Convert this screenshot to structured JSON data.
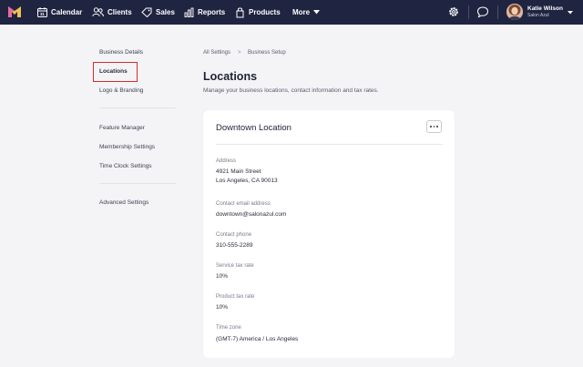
{
  "nav": {
    "items": [
      {
        "label": "Calendar",
        "icon": "calendar-icon"
      },
      {
        "label": "Clients",
        "icon": "clients-icon"
      },
      {
        "label": "Sales",
        "icon": "sales-tag-icon"
      },
      {
        "label": "Reports",
        "icon": "reports-icon"
      },
      {
        "label": "Products",
        "icon": "products-icon"
      }
    ],
    "more_label": "More",
    "user_name": "Katie Wilson",
    "user_business": "Salon Azul",
    "accent": "#1f2440"
  },
  "sidebar": {
    "group1": [
      "Business Details",
      "Locations",
      "Logo & Branding"
    ],
    "group2": [
      "Feature Manager",
      "Membership Settings",
      "Time Clock Settings"
    ],
    "group3": [
      "Advanced Settings"
    ],
    "active": "Locations"
  },
  "breadcrumb": {
    "root": "All Settings",
    "separator": ">",
    "current": "Business Setup"
  },
  "page": {
    "title": "Locations",
    "subtitle": "Manage your business locations, contact information and tax rates."
  },
  "location": {
    "name": "Downtown Location",
    "address_label": "Address",
    "address_line1": "4921 Main Street",
    "address_line2": "Los Angeles, CA 90013",
    "email_label": "Contact email address",
    "email": "downtown@salonazul.com",
    "phone_label": "Contact phone",
    "phone": "310-555-2289",
    "service_tax_label": "Service tax rate",
    "service_tax": "10%",
    "product_tax_label": "Product tax rate",
    "product_tax": "10%",
    "timezone_label": "Time zone",
    "timezone": "(GMT-7) America / Los Angeles"
  }
}
